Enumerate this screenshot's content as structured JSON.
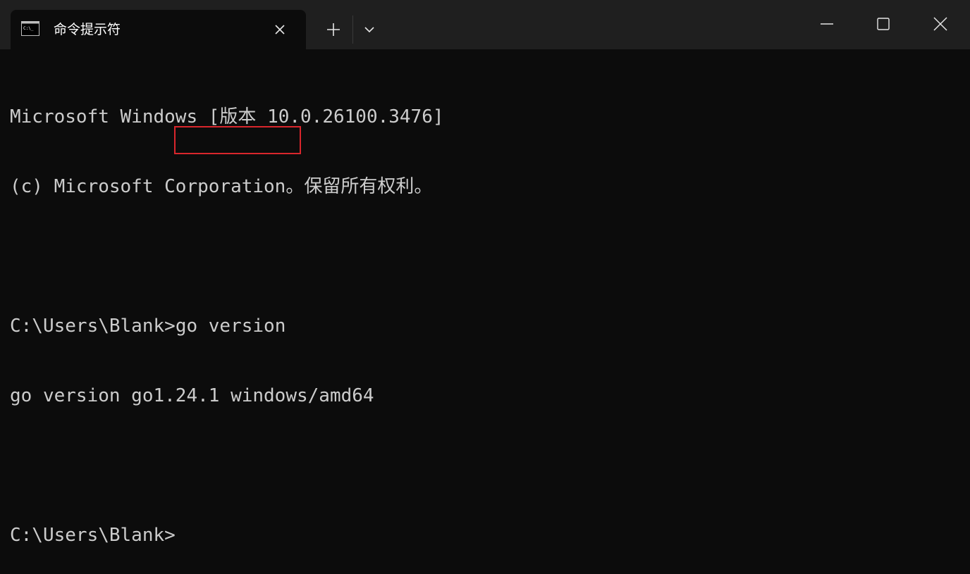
{
  "window": {
    "tab_title": "命令提示符",
    "tab_icon": "terminal-icon",
    "close_tab_icon": "close-icon",
    "new_tab_icon": "plus-icon",
    "dropdown_icon": "chevron-down-icon",
    "minimize_icon": "minimize-icon",
    "maximize_icon": "maximize-icon",
    "close_window_icon": "close-icon"
  },
  "terminal": {
    "lines": [
      "Microsoft Windows [版本 10.0.26100.3476]",
      "(c) Microsoft Corporation。保留所有权利。",
      "",
      "C:\\Users\\Blank>",
      "go version go1.24.1 windows/amd64",
      "",
      "C:\\Users\\Blank>"
    ],
    "command": "go version",
    "highlight_color": "#d9262c"
  },
  "colors": {
    "background": "#0c0c0c",
    "titlebar": "#1f1f1f",
    "text": "#cccccc"
  }
}
